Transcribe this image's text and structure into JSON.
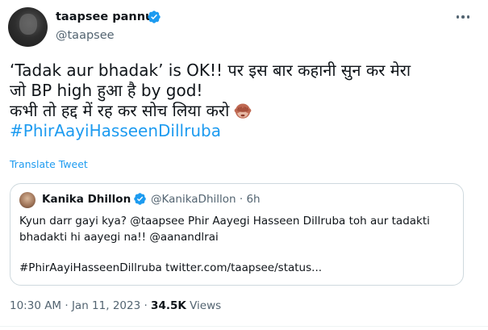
{
  "author": {
    "display_name": "taapsee pannu",
    "handle": "@taapsee"
  },
  "tweet": {
    "line1": "‘Tadak aur bhadak’ is OK!! पर इस बार कहानी सुन कर मेरा",
    "line2": "जो BP high हुआ है by god!",
    "line3": "कभी तो हद्द में रह कर सोच लिया करो",
    "hashtag": "#PhirAayiHasseenDillruba",
    "emoji_name": "see-no-evil-monkey-icon",
    "translate_label": "Translate Tweet"
  },
  "quoted_tweet": {
    "display_name": "Kanika Dhillon",
    "handle_time": "@KanikaDhillon · 6h",
    "line1": "Kyun darr gayi kya? @taapsee Phir Aayegi Hasseen Dillruba toh aur tadakti",
    "line2": "bhadakti hi aayegi na!! @aanandlrai",
    "line3": "#PhirAayiHasseenDillruba twitter.com/taapsee/status..."
  },
  "meta": {
    "time_date": "10:30 AM · Jan 11, 2023 · ",
    "views_count": "34.5K",
    "views_label": " Views"
  },
  "colors": {
    "link": "#1d9bf0",
    "secondary_text": "#536471",
    "border": "#cfd9de",
    "verified_badge": "#1d9bf0"
  }
}
